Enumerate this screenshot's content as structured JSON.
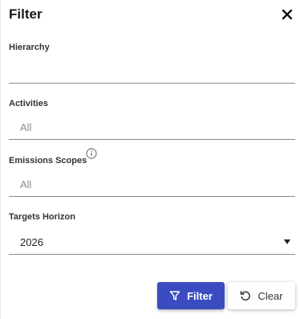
{
  "header": {
    "title": "Filter",
    "close_icon": "close-icon"
  },
  "fields": {
    "hierarchy": {
      "label": "Hierarchy",
      "value": ""
    },
    "activities": {
      "label": "Activities",
      "value": "All"
    },
    "emissions_scopes": {
      "label": "Emissions Scopes",
      "value": "All",
      "info_icon": "info-icon"
    },
    "targets_horizon": {
      "label": "Targets Horizon",
      "value": "2026",
      "dropdown_icon": "caret-down-icon"
    }
  },
  "actions": {
    "filter_label": "Filter",
    "filter_icon": "funnel-icon",
    "clear_label": "Clear",
    "clear_icon": "undo-icon",
    "accent_color": "#3b4cc0"
  }
}
